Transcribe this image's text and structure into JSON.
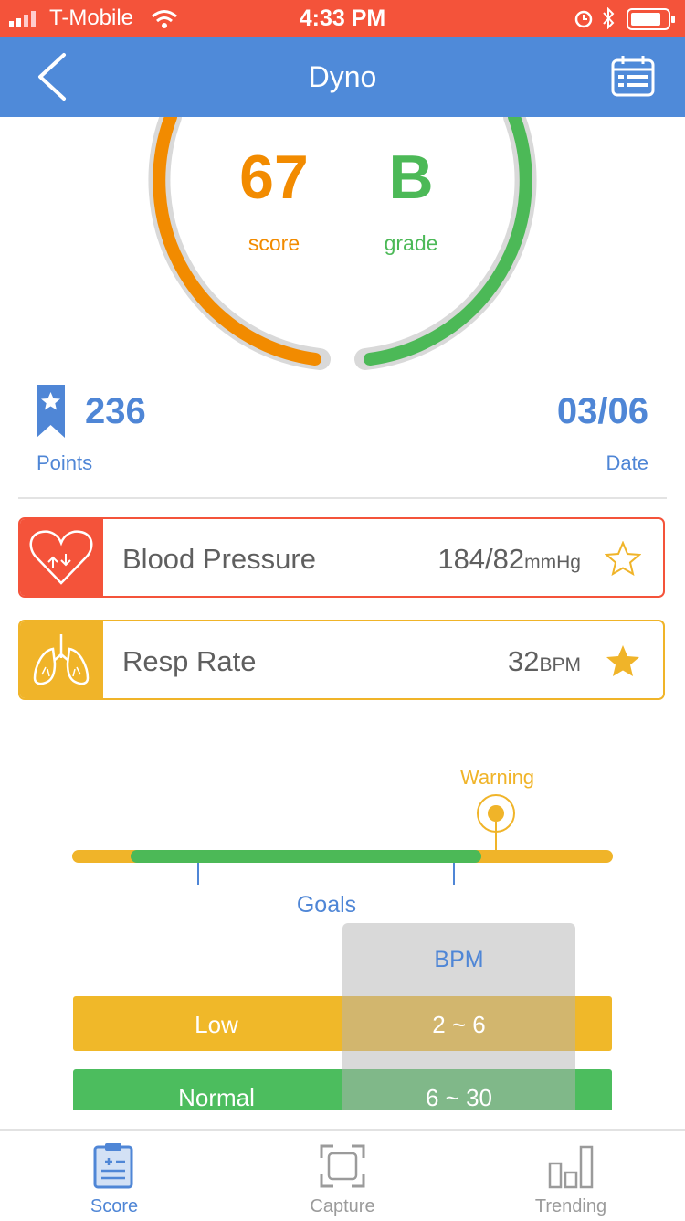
{
  "status_bar": {
    "carrier": "T-Mobile",
    "time": "4:33 PM"
  },
  "header": {
    "title": "Dyno",
    "back_icon": "chevron-left-icon",
    "calendar_icon": "calendar-icon"
  },
  "summary": {
    "score": "67",
    "score_label": "score",
    "grade": "B",
    "grade_label": "grade",
    "points_value": "236",
    "points_label": "Points",
    "date_value": "03/06",
    "date_label": "Date"
  },
  "vitals": [
    {
      "name": "Blood Pressure",
      "value": "184/82",
      "unit": "mmHg",
      "starred": false,
      "icon": "heart-icon"
    },
    {
      "name": "Resp Rate",
      "value": "32",
      "unit": "BPM",
      "starred": true,
      "icon": "lungs-icon"
    }
  ],
  "gauge": {
    "marker_label": "Warning"
  },
  "goals": {
    "title": "Goals",
    "column_header": "BPM",
    "rows": [
      {
        "label": "Low",
        "range": "2 ~ 6"
      },
      {
        "label": "Normal",
        "range": "6 ~ 30"
      }
    ]
  },
  "tabs": [
    {
      "label": "Score",
      "icon": "clipboard-icon",
      "active": true
    },
    {
      "label": "Capture",
      "icon": "capture-frame-icon",
      "active": false
    },
    {
      "label": "Trending",
      "icon": "bar-chart-icon",
      "active": false
    }
  ],
  "colors": {
    "status_bar": "#f4533a",
    "nav": "#4f8ad9",
    "score": "#f28b00",
    "grade": "#4cb957",
    "blood_pressure": "#f4533a",
    "resp_rate": "#f0b429",
    "active_tab": "#4f86d6"
  }
}
